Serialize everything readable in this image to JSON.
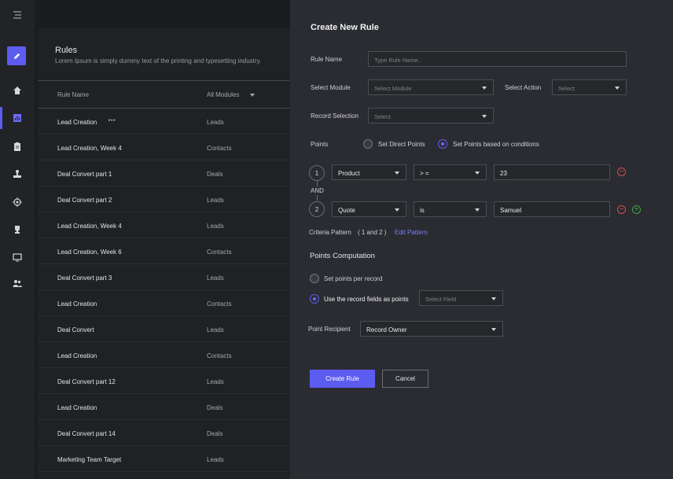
{
  "sidebar": {
    "items": [
      "menu-icon",
      "edit-icon",
      "home-icon",
      "chart-icon",
      "clipboard-icon",
      "stamp-icon",
      "target-icon",
      "trophy-icon",
      "monitor-icon",
      "users-icon"
    ],
    "accent": "#5d5cf0"
  },
  "list": {
    "title": "Rules",
    "subtitle": "Lorem Ipsum is simply dummy text of the printing and typesetting industry.",
    "col_name": "Rule Name",
    "col_module": "All Modules",
    "rows": [
      {
        "name": "Lead Creation",
        "module": "Leads"
      },
      {
        "name": "Lead Creation, Week 4",
        "module": "Contacts"
      },
      {
        "name": "Deal Convert part 1",
        "module": "Deals"
      },
      {
        "name": "Deal Convert part 2",
        "module": "Leads"
      },
      {
        "name": "Lead Creation, Week 4",
        "module": "Leads"
      },
      {
        "name": "Lead Creation, Week 6",
        "module": "Contacts"
      },
      {
        "name": "Deal Convert part 3",
        "module": "Leads"
      },
      {
        "name": "Lead Creation",
        "module": "Contacts"
      },
      {
        "name": "Deal Convert",
        "module": "Leads"
      },
      {
        "name": "Lead Creation",
        "module": "Contacts"
      },
      {
        "name": "Deal Convert part 12",
        "module": "Leads"
      },
      {
        "name": "Lead Creation",
        "module": "Deals"
      },
      {
        "name": "Deal Convert part 14",
        "module": "Deals"
      },
      {
        "name": "Marketing Team Target",
        "module": "Leads"
      }
    ]
  },
  "drawer": {
    "title": "Create New Rule",
    "rule_name_label": "Rule Name",
    "rule_name_placeholder": "Type Rule Name..",
    "module_label": "Select Module",
    "module_placeholder": "Select Module",
    "action_label": "Select Action",
    "action_placeholder": "Select",
    "record_label": "Record Selection",
    "record_placeholder": "Select",
    "points_label": "Points",
    "points_opt1": "Set Direct Points",
    "points_opt2": "Set Points based on conditions",
    "criteria": [
      {
        "num": "1",
        "field": "Product",
        "op": "> =",
        "value": "23"
      },
      {
        "num": "2",
        "field": "Quote",
        "op": "is",
        "value": "Samuel"
      }
    ],
    "and_label": "AND",
    "pattern_label": "Criteria Pattern",
    "pattern_value": "( 1 and 2 )",
    "edit_pattern": "Edit Pattern",
    "computation_title": "Points Computation",
    "comp_opt1": "Set points per record",
    "comp_opt2": "Use the record fields as points",
    "select_field_placeholder": "Select Field",
    "recipient_label": "Point Recipient",
    "recipient_value": "Record Owner",
    "create_button": "Create Rule",
    "cancel_button": "Cancel"
  }
}
